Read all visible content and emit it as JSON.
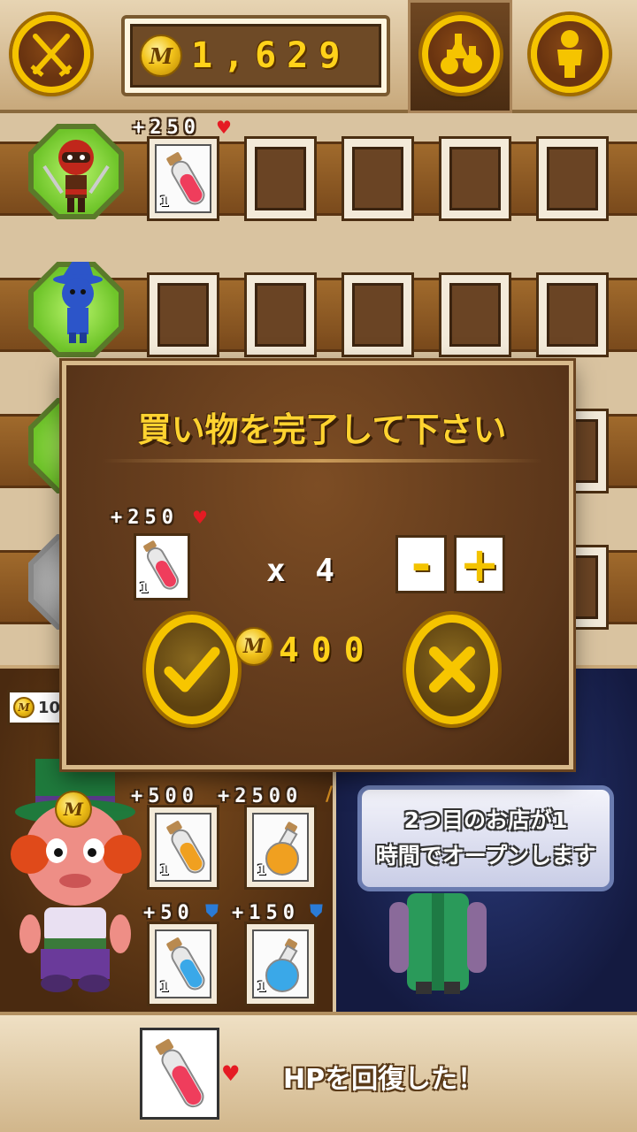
{
  "header": {
    "battle_icon": "crossed-swords-icon",
    "coin_letter": "M",
    "coins": "1,629",
    "shop_icon": "potions-icon",
    "character_icon": "person-icon"
  },
  "slots": {
    "row1_bonus": "+250",
    "row1_qty": "1"
  },
  "dialog": {
    "title": "買い物を完了して下さい",
    "item_bonus": "+250",
    "item_qty": "1",
    "multiplier": "x 4",
    "minus": "-",
    "plus": "+",
    "price": "400",
    "confirm_icon": "checkmark-icon",
    "cancel_icon": "close-icon"
  },
  "shop": {
    "partial_price": "10",
    "items": [
      {
        "bonus": "+500",
        "qty": "1",
        "stat": "heart",
        "color": "#f0a020"
      },
      {
        "bonus": "+2500",
        "qty": "1",
        "stat": "sword",
        "color": "#f0a020"
      },
      {
        "bonus": "+50",
        "qty": "1",
        "stat": "shield",
        "color": "#3aa8e8"
      },
      {
        "bonus": "+150",
        "qty": "1",
        "stat": "shield",
        "color": "#3aa8e8"
      }
    ],
    "second_shop_line1": "2つ目のお店が1",
    "second_shop_line2": "時間でオープンします"
  },
  "footer": {
    "message": "HPを回復した！"
  },
  "colors": {
    "gold": "#f5c400",
    "potion_red": "#ef3d5c",
    "potion_orange": "#f0a020",
    "potion_blue": "#3aa8e8"
  }
}
